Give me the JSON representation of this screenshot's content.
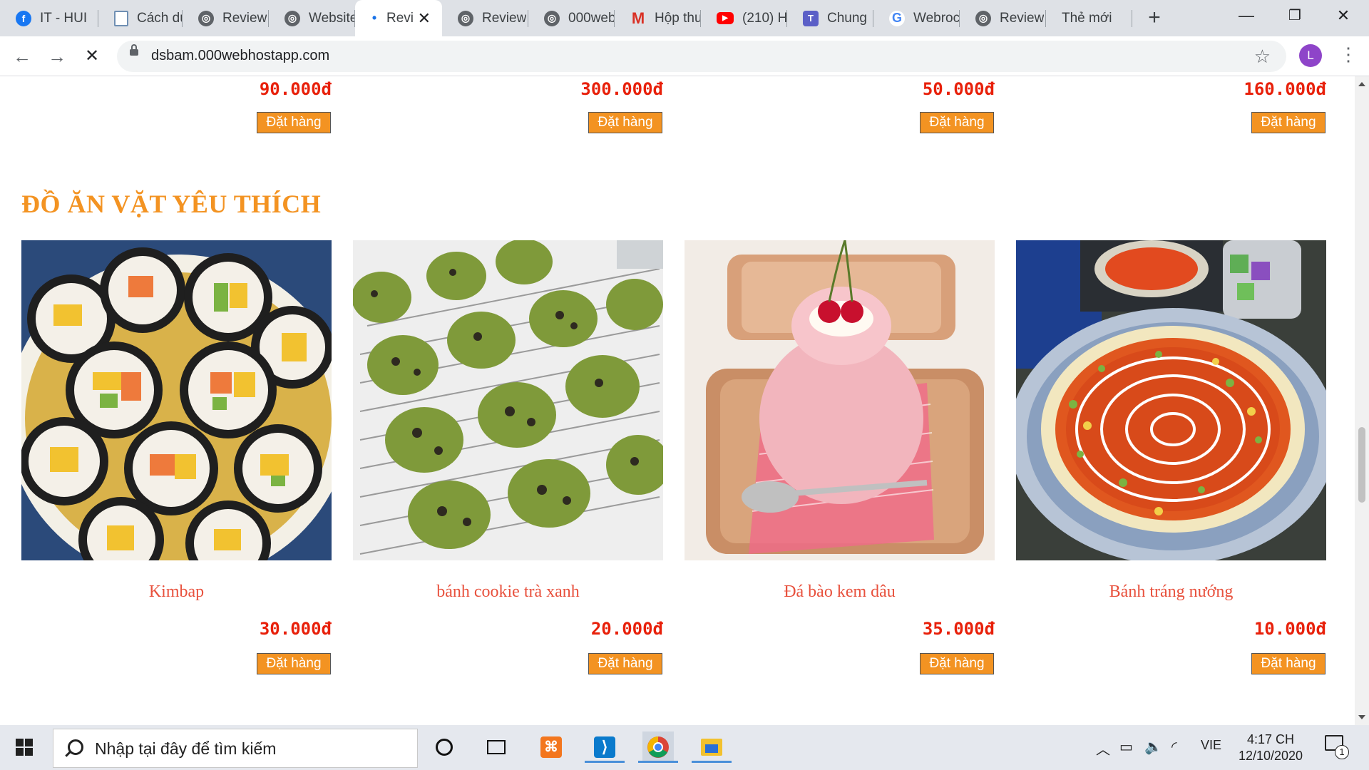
{
  "browser": {
    "tabs": [
      {
        "label": "IT - HUI",
        "favicon": "facebook-icon",
        "color": "#1877f2"
      },
      {
        "label": "Cách dù",
        "favicon": "document-icon",
        "color": "#6f8fb3"
      },
      {
        "label": "Review",
        "favicon": "globe-icon",
        "color": "#5f6368"
      },
      {
        "label": "Website",
        "favicon": "globe-icon",
        "color": "#5f6368"
      },
      {
        "label": "Revi",
        "favicon": "loading-icon",
        "color": "#1a73e8",
        "active": true
      },
      {
        "label": "Review",
        "favicon": "globe-icon",
        "color": "#5f6368"
      },
      {
        "label": "000web",
        "favicon": "globe-icon",
        "color": "#5f6368"
      },
      {
        "label": "Hộp thư",
        "favicon": "gmail-icon",
        "color": "#d93025"
      },
      {
        "label": "(210) H",
        "favicon": "youtube-icon",
        "color": "#ff0000"
      },
      {
        "label": "Chung",
        "favicon": "teams-icon",
        "color": "#5b5fc7"
      },
      {
        "label": "Webroc",
        "favicon": "google-icon",
        "color": "#4285f4"
      },
      {
        "label": "Review",
        "favicon": "globe-icon",
        "color": "#5f6368"
      },
      {
        "label": "Thẻ mới",
        "favicon": "",
        "color": ""
      }
    ],
    "url": "dsbam.000webhostapp.com",
    "profile_initial": "L"
  },
  "page": {
    "top_row": {
      "prices": [
        "90.000đ",
        "300.000đ",
        "50.000đ",
        "160.000đ"
      ],
      "order_label": "Đặt hàng"
    },
    "section_title": "ĐỒ ĂN VẶT YÊU THÍCH",
    "products": [
      {
        "name": "Kimbap",
        "price": "30.000đ",
        "order_label": "Đặt hàng",
        "image": "kimbap-photo"
      },
      {
        "name": "bánh cookie trà xanh",
        "price": "20.000đ",
        "order_label": "Đặt hàng",
        "image": "green-tea-muffin-photo"
      },
      {
        "name": "Đá bào kem dâu",
        "price": "35.000đ",
        "order_label": "Đặt hàng",
        "image": "strawberry-shaved-ice-photo"
      },
      {
        "name": "Bánh tráng nướng",
        "price": "10.000đ",
        "order_label": "Đặt hàng",
        "image": "grilled-rice-paper-photo"
      }
    ],
    "colors": {
      "accent": "#f39322",
      "price": "#e8200a",
      "product_name": "#e8513d"
    }
  },
  "taskbar": {
    "search_placeholder": "Nhập tại đây để tìm kiếm",
    "language": "VIE",
    "time": "4:17 CH",
    "date": "12/10/2020",
    "notification_count": "1"
  }
}
